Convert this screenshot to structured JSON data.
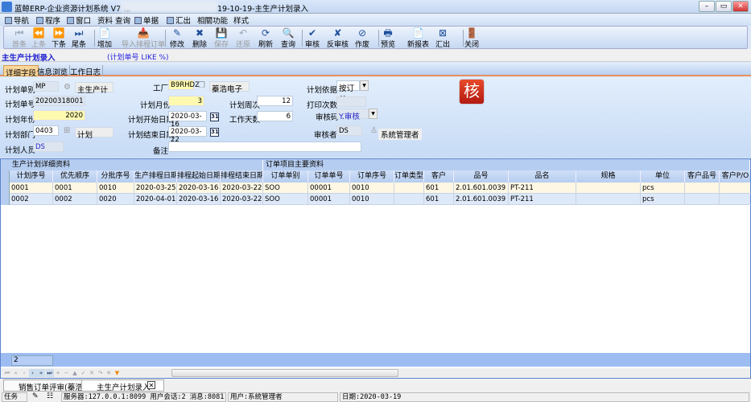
{
  "window": {
    "title_left": "蓝鲸ERP-企业资源计划系统 V7 帐",
    "title_right": "19-10-19-主生产计划录入",
    "controls": [
      "–",
      "▭",
      "✕"
    ]
  },
  "menu": [
    {
      "label": "导航",
      "icon": "navigate-icon"
    },
    {
      "label": "程序",
      "icon": "program-icon"
    },
    {
      "label": "窗口",
      "icon": "window-icon"
    },
    {
      "label": "资料"
    },
    {
      "label": "查询"
    },
    {
      "label": "单据",
      "icon": "document-icon"
    },
    {
      "label": "汇出",
      "icon": "export-icon"
    },
    {
      "label": "相關功能"
    },
    {
      "label": "样式"
    }
  ],
  "toolbar": [
    {
      "label": "首条",
      "icon": "⏮",
      "enabled": false
    },
    {
      "label": "上条",
      "icon": "⏪",
      "enabled": false
    },
    {
      "label": "下条",
      "icon": "⏩",
      "enabled": true
    },
    {
      "label": "尾条",
      "icon": "⏭",
      "enabled": true
    },
    {
      "label": "增加",
      "icon": "📄",
      "enabled": true
    },
    {
      "label": "导入排程订单",
      "icon": "📥",
      "enabled": false
    },
    {
      "label": "修改",
      "icon": "✎",
      "enabled": true
    },
    {
      "label": "删除",
      "icon": "✖",
      "enabled": true
    },
    {
      "label": "保存",
      "icon": "💾",
      "enabled": false
    },
    {
      "label": "还原",
      "icon": "↶",
      "enabled": false
    },
    {
      "label": "刷新",
      "icon": "⟳",
      "enabled": true
    },
    {
      "label": "查询",
      "icon": "🔍",
      "enabled": true
    },
    {
      "label": "审核",
      "icon": "✔",
      "enabled": true
    },
    {
      "label": "反审核",
      "icon": "✘",
      "enabled": true
    },
    {
      "label": "作废",
      "icon": "⊘",
      "enabled": true
    },
    {
      "label": "预览",
      "icon": "🖶",
      "enabled": true
    },
    {
      "label": "新报表",
      "icon": "📄",
      "enabled": true
    },
    {
      "label": "汇出",
      "icon": "⊠",
      "enabled": true
    },
    {
      "label": "关闭",
      "icon": "🚪",
      "enabled": true
    }
  ],
  "header": {
    "title": "主生产计划录入",
    "filter": "(计划单号 LIKE %)"
  },
  "tabs": [
    {
      "label": "详细字段",
      "active": true
    },
    {
      "label": "信息浏览"
    },
    {
      "label": "工作日志"
    }
  ],
  "form": {
    "plan_type": {
      "label": "计划单别",
      "value": "MP",
      "name": "主生产计划"
    },
    "plan_no": {
      "label": "计划单号",
      "value": "20200318001"
    },
    "plan_year": {
      "label": "计划年份",
      "value": "2020"
    },
    "plan_dept": {
      "label": "计划部门",
      "value": "0403",
      "name": "计划"
    },
    "planner": {
      "label": "计划人员",
      "value": "DS"
    },
    "factory": {
      "label": "工厂",
      "value": "B9RHDZ",
      "name": "蓁浩电子"
    },
    "plan_month": {
      "label": "计划月份",
      "value": "3"
    },
    "start_date": {
      "label": "计划开始日期",
      "value": "2020-03-16"
    },
    "end_date": {
      "label": "计划结束日期",
      "value": "2020-03-22"
    },
    "remark": {
      "label": "备注",
      "value": ""
    },
    "plan_week": {
      "label": "计划周次",
      "value": "12"
    },
    "work_days": {
      "label": "工作天数",
      "value": "6"
    },
    "plan_basis": {
      "label": "计划依据",
      "value": "按订单"
    },
    "print_count": {
      "label": "打印次数",
      "value": ""
    },
    "audit_code": {
      "label": "审核码",
      "value": "Y.审核"
    },
    "auditor": {
      "label": "审核者",
      "value": "DS",
      "name": "系統管理者"
    },
    "audit_badge": "核",
    "calendar_icon_text": "31"
  },
  "grid": {
    "groups": [
      "生产计划详细资料",
      "订单项目主要资料"
    ],
    "columns": [
      "计划序号",
      "优先顺序",
      "分批序号",
      "生产排程日期",
      "排程起始日期",
      "排程结束日期",
      "订单单别",
      "订单单号",
      "订单序号",
      "订单类型",
      "客户",
      "品号",
      "品名",
      "规格",
      "单位",
      "客户品号",
      "客户P/O"
    ],
    "rows": [
      [
        "0001",
        "0001",
        "0010",
        "2020-03-25",
        "2020-03-16",
        "2020-03-22",
        "SOO",
        "00001",
        "0010",
        "",
        "601",
        "2.01.601.0039",
        "PT-211",
        "",
        "pcs",
        "",
        ""
      ],
      [
        "0002",
        "0002",
        "0020",
        "2020-04-01",
        "2020-03-16",
        "2020-03-22",
        "SOO",
        "00001",
        "0010",
        "",
        "601",
        "2.01.601.0039",
        "PT-211",
        "",
        "pcs",
        "",
        ""
      ]
    ],
    "row_count": "2"
  },
  "bottom_tabs": [
    {
      "label": "销售订单评审(蓁浩)"
    },
    {
      "label": "主生产计划录入",
      "close": "✕"
    }
  ],
  "status": {
    "task": "任务",
    "server": "服务器:127.0.0.1:8099 用户会话:2 消息:8081",
    "user": "用户:系統管理者",
    "date": "日期:2020-03-19"
  }
}
